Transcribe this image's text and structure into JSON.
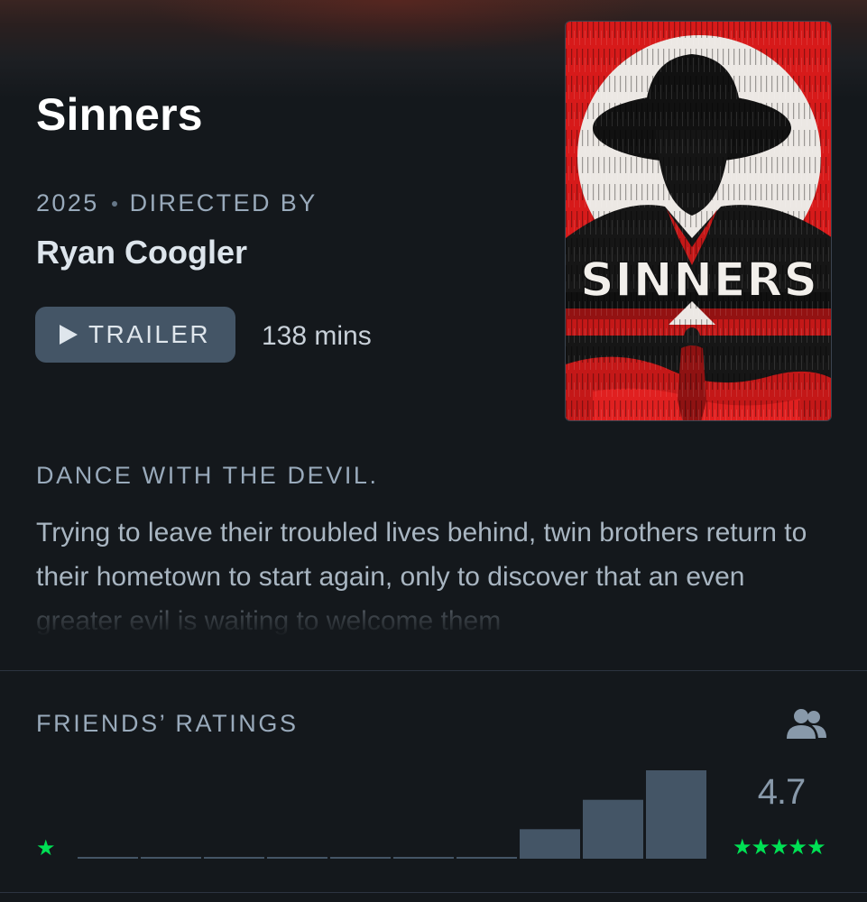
{
  "film": {
    "title": "Sinners",
    "year": "2025",
    "directed_by_label": "DIRECTED BY",
    "director": "Ryan Coogler",
    "trailer_label": "TRAILER",
    "runtime": "138 mins",
    "tagline": "DANCE WITH THE DEVIL.",
    "synopsis": "Trying to leave their troubled lives behind, twin brothers return to their hometown to start again, only to discover that an even greater evil is waiting to welcome them",
    "poster_title": "SINNERS"
  },
  "ratings": {
    "label": "FRIENDS’ RATINGS",
    "average": "4.7",
    "min_star": "★",
    "max_stars": "★★★★★"
  },
  "chart_data": {
    "type": "bar",
    "categories": [
      "0.5",
      "1",
      "1.5",
      "2",
      "2.5",
      "3",
      "3.5",
      "4",
      "4.5",
      "5"
    ],
    "values": [
      0,
      0,
      0,
      0,
      0,
      0,
      0,
      1,
      2,
      3
    ]
  },
  "colors": {
    "background": "#14181c",
    "accent_green": "#00e054",
    "bar": "#445566",
    "muted_text": "#99aabb"
  },
  "icons": {
    "trailer": "play-icon",
    "friends": "friends-icon"
  }
}
